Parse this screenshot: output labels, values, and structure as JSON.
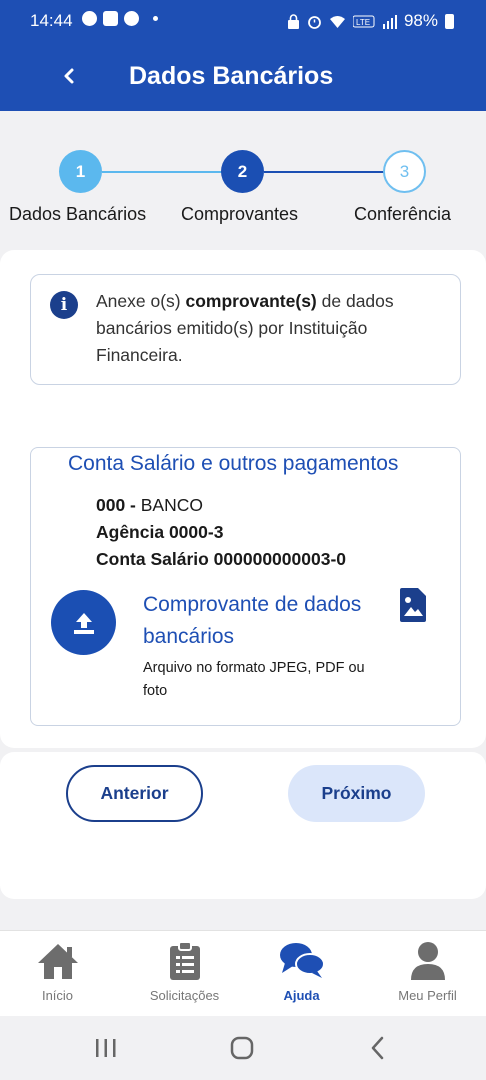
{
  "status_bar": {
    "time": "14:44",
    "battery": "98%"
  },
  "app_bar": {
    "title": "Dados Bancários"
  },
  "stepper": {
    "steps": [
      {
        "number": "1",
        "label": "Dados Bancários",
        "state": "completed"
      },
      {
        "number": "2",
        "label": "Comprovantes",
        "state": "current"
      },
      {
        "number": "3",
        "label": "Conferência",
        "state": "upcoming"
      }
    ]
  },
  "info": {
    "text_before": "Anexe o(s) ",
    "text_bold": "comprovante(s)",
    "text_after": " de dados bancários emitido(s) por Instituição Financeira."
  },
  "account": {
    "title": "Conta Salário e outros pagamentos",
    "bank_code": "000 -",
    "bank_name": " BANCO",
    "agency": "Agência 0000-3",
    "account": "Conta Salário 000000000003-0"
  },
  "upload": {
    "title": "Comprovante de dados bancários",
    "subtitle": "Arquivo no formato JPEG, PDF ou foto"
  },
  "buttons": {
    "previous": "Anterior",
    "next": "Próximo"
  },
  "bottom_nav": {
    "items": [
      {
        "label": "Início",
        "icon": "home-icon",
        "active": false
      },
      {
        "label": "Solicitações",
        "icon": "clipboard-icon",
        "active": false
      },
      {
        "label": "Ajuda",
        "icon": "chat-icon",
        "active": true
      },
      {
        "label": "Meu Perfil",
        "icon": "person-icon",
        "active": false
      }
    ]
  },
  "colors": {
    "primary": "#1e4fb4",
    "dark": "#1b3f8c",
    "step_done": "#5bb8ee",
    "next_bg": "#dbe6fa"
  }
}
